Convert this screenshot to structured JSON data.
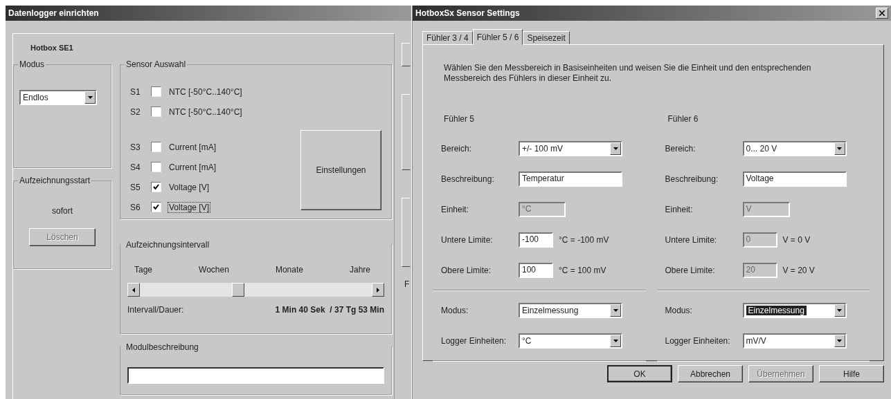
{
  "left_window": {
    "title": "Datenlogger einrichten",
    "device_tab": "Hotbox SE1",
    "modus": {
      "label": "Modus",
      "value": "Endlos"
    },
    "start": {
      "label": "Aufzeichnungsstart",
      "text": "sofort",
      "button": {
        "label": "Löschen",
        "disabled": true
      }
    },
    "sensor_selection": {
      "label": "Sensor Auswahl",
      "items": [
        {
          "id": "S1",
          "label": "NTC [-50°C..140°C]",
          "checked": false,
          "focused": false,
          "gap": false
        },
        {
          "id": "S2",
          "label": "NTC [-50°C..140°C]",
          "checked": false,
          "focused": false,
          "gap": false
        },
        {
          "id": "S3",
          "label": "Current [mA]",
          "checked": false,
          "focused": false,
          "gap": true
        },
        {
          "id": "S4",
          "label": "Current [mA]",
          "checked": false,
          "focused": false,
          "gap": false
        },
        {
          "id": "S5",
          "label": "Voltage [V]",
          "checked": true,
          "focused": false,
          "gap": false
        },
        {
          "id": "S6",
          "label": "Voltage [V]",
          "checked": true,
          "focused": true,
          "gap": false
        }
      ],
      "button": "Einstellungen"
    },
    "interval": {
      "label": "Aufzeichnungsintervall",
      "scale": [
        "Tage",
        "Wochen",
        "Monate",
        "Jahre"
      ],
      "level": 0.42,
      "caption": "Intervall/Dauer:",
      "value": "1 Min 40 Sek  / 37 Tg 53 Min"
    },
    "description": {
      "label": "Modulbeschreibung"
    },
    "cut_label": "F"
  },
  "right_window": {
    "title": "HotboxSx Sensor Settings",
    "tabs": [
      {
        "label": "Fühler 3 / 4",
        "selected": false
      },
      {
        "label": "Fühler 5 / 6",
        "selected": true
      },
      {
        "label": "Speisezeit",
        "selected": false
      }
    ],
    "intro": "Wählen Sie den Messbereich in Basiseinheiten und weisen Sie die Einheit und den entsprechenden Messbereich des Fühlers in dieser Einheit zu.",
    "sensors": [
      {
        "title": "Fühler 5",
        "rows": [
          {
            "kind": "select",
            "label": "Bereich:",
            "value": "+/- 100 mV"
          },
          {
            "kind": "text",
            "label": "Beschreibung:",
            "value": "Temperatur",
            "disabled": false
          },
          {
            "kind": "unit",
            "label": "Einheit:",
            "value": "°C",
            "disabled": true
          },
          {
            "kind": "limit",
            "label": "Untere Limite:",
            "value": "-100",
            "suffix": "°C = -100 mV",
            "disabled": false
          },
          {
            "kind": "limit",
            "label": "Obere Limite:",
            "value": "100",
            "suffix": "°C = 100 mV",
            "disabled": false
          }
        ],
        "mode": {
          "label": "Modus:",
          "value": "Einzelmessung",
          "highlighted": false
        },
        "logger_units": {
          "label": "Logger Einheiten:",
          "value": "°C"
        }
      },
      {
        "title": "Fühler 6",
        "rows": [
          {
            "kind": "select",
            "label": "Bereich:",
            "value": "0... 20 V"
          },
          {
            "kind": "text",
            "label": "Beschreibung:",
            "value": "Voltage",
            "disabled": false
          },
          {
            "kind": "unit",
            "label": "Einheit:",
            "value": "V",
            "disabled": true
          },
          {
            "kind": "limit",
            "label": "Untere Limite:",
            "value": "0",
            "suffix": "V = 0 V",
            "disabled": true
          },
          {
            "kind": "limit",
            "label": "Obere Limite:",
            "value": "20",
            "suffix": "V = 20 V",
            "disabled": true
          }
        ],
        "mode": {
          "label": "Modus:",
          "value": "Einzelmessung",
          "highlighted": true
        },
        "logger_units": {
          "label": "Logger Einheiten:",
          "value": "mV/V"
        }
      }
    ],
    "buttons": [
      {
        "label": "OK",
        "disabled": false
      },
      {
        "label": "Abbrechen",
        "disabled": false
      },
      {
        "label": "Übernehmen",
        "disabled": true
      },
      {
        "label": "Hilfe",
        "disabled": false
      }
    ]
  }
}
